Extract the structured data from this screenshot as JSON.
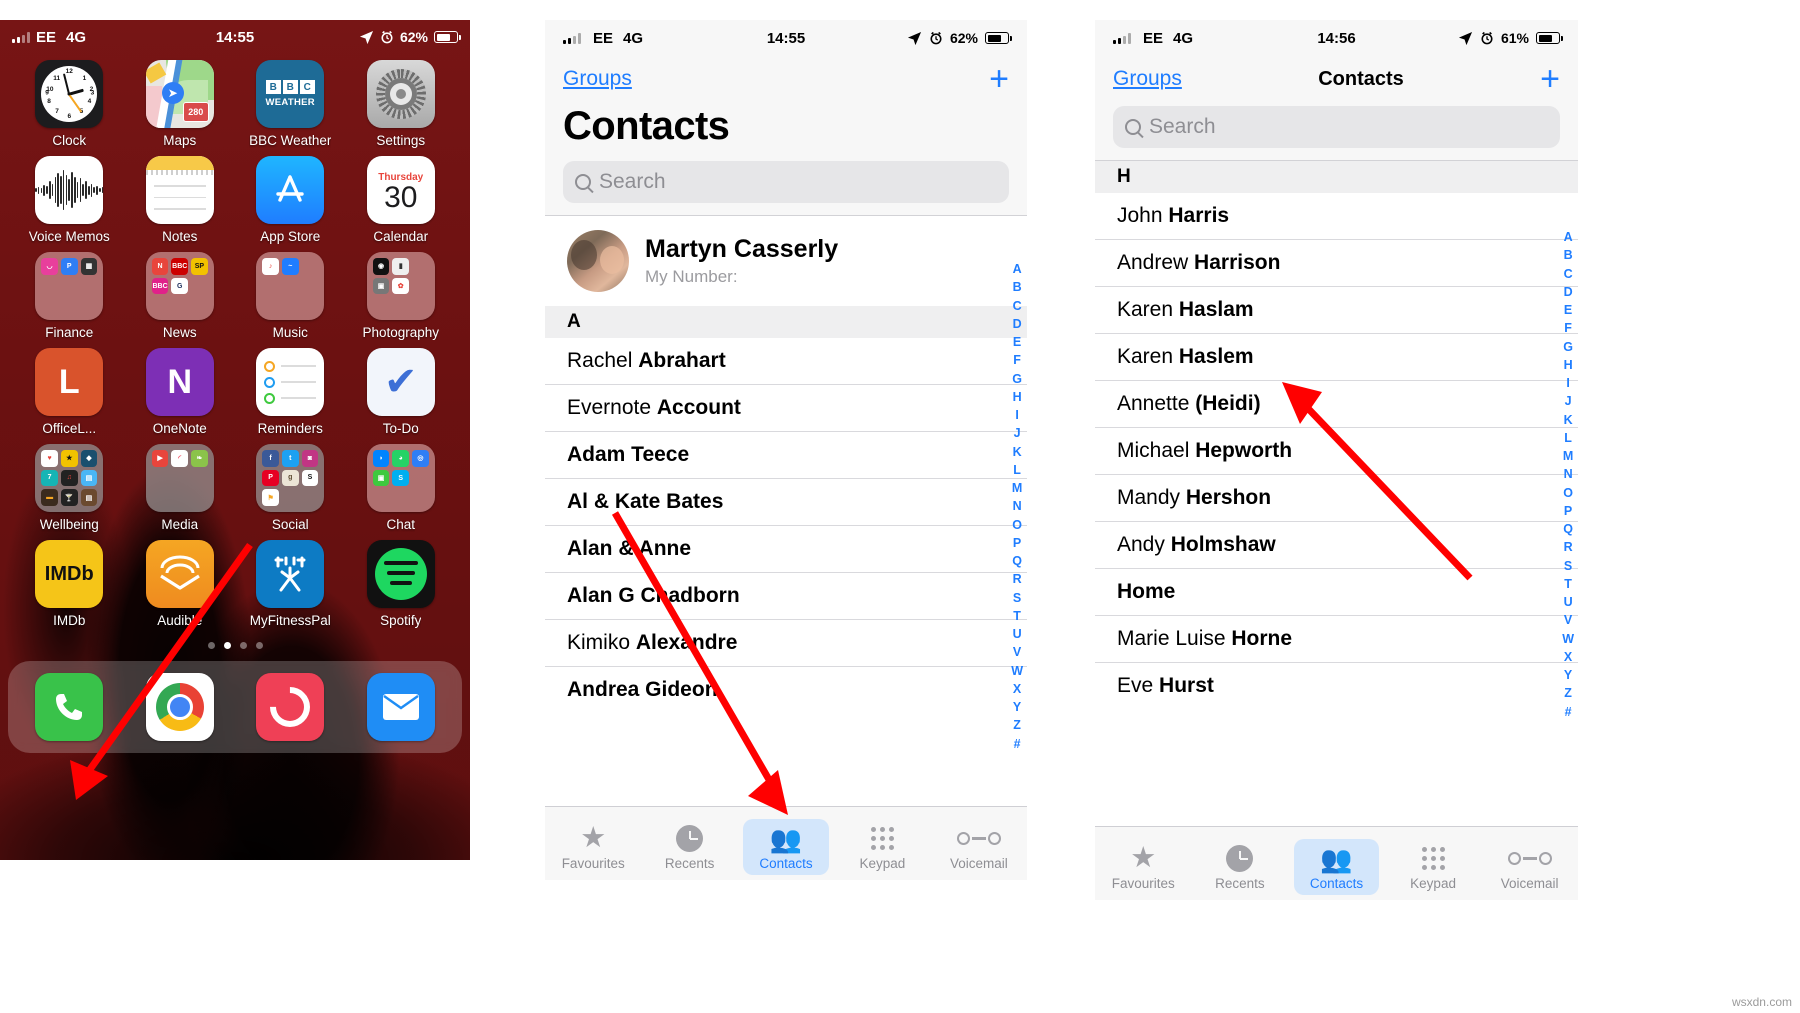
{
  "meta": {
    "watermark": "wsxdn.com",
    "accent_blue": "#1f7dff",
    "arrow_color": "#ff0000",
    "home_bg": "#6e1212"
  },
  "panel_home": {
    "status": {
      "signal": "signal-bars",
      "carrier": "EE",
      "network": "4G",
      "time": "14:55",
      "location": "location-arrow",
      "alarm": "alarm-clock",
      "battery_percent": "62%"
    },
    "apps": [
      {
        "label": "Clock",
        "icon": "clock-icon"
      },
      {
        "label": "Maps",
        "icon": "maps-icon",
        "badge": "280"
      },
      {
        "label": "BBC Weather",
        "icon": "bbc-weather-icon",
        "line1": [
          "B",
          "B",
          "C"
        ],
        "line2": "WEATHER"
      },
      {
        "label": "Settings",
        "icon": "settings-gear-icon"
      },
      {
        "label": "Voice Memos",
        "icon": "voice-memos-icon"
      },
      {
        "label": "Notes",
        "icon": "notes-icon"
      },
      {
        "label": "App Store",
        "icon": "app-store-icon"
      },
      {
        "label": "Calendar",
        "icon": "calendar-icon",
        "weekday": "Thursday",
        "day": "30"
      },
      {
        "label": "Finance",
        "icon": "folder-icon"
      },
      {
        "label": "News",
        "icon": "folder-icon"
      },
      {
        "label": "Music",
        "icon": "folder-icon"
      },
      {
        "label": "Photography",
        "icon": "folder-icon"
      },
      {
        "label": "OfficeL...",
        "icon": "office-lens-icon",
        "glyph": "L",
        "badge_dot": true
      },
      {
        "label": "OneNote",
        "icon": "onenote-icon",
        "glyph": "N"
      },
      {
        "label": "Reminders",
        "icon": "reminders-icon"
      },
      {
        "label": "To-Do",
        "icon": "to-do-icon"
      },
      {
        "label": "Wellbeing",
        "icon": "folder-icon"
      },
      {
        "label": "Media",
        "icon": "folder-icon"
      },
      {
        "label": "Social",
        "icon": "folder-icon"
      },
      {
        "label": "Chat",
        "icon": "folder-icon"
      },
      {
        "label": "IMDb",
        "icon": "imdb-icon",
        "glyph": "IMDb"
      },
      {
        "label": "Audible",
        "icon": "audible-icon"
      },
      {
        "label": "MyFitnessPal",
        "icon": "myfitnesspal-icon"
      },
      {
        "label": "Spotify",
        "icon": "spotify-icon"
      }
    ],
    "page_dots": {
      "count": 4,
      "active_index": 1
    },
    "dock": [
      {
        "label": "Phone",
        "icon": "phone-icon"
      },
      {
        "label": "Chrome",
        "icon": "chrome-icon"
      },
      {
        "label": "Pocket Casts",
        "icon": "pocket-casts-icon"
      },
      {
        "label": "Mail",
        "icon": "mail-icon"
      }
    ]
  },
  "panel_contacts": {
    "status": {
      "carrier": "EE",
      "network": "4G",
      "time": "14:55",
      "battery_percent": "62%"
    },
    "nav": {
      "back_label": "Groups",
      "add_label": "+"
    },
    "title": "Contacts",
    "search": {
      "placeholder": "Search"
    },
    "me": {
      "name": "Martyn Casserly",
      "number_label": "My Number:",
      "number_value": ""
    },
    "sections": [
      {
        "letter": "A",
        "contacts": [
          {
            "first": "Rachel ",
            "last": "Abrahart"
          },
          {
            "first": "Evernote ",
            "last": "Account"
          },
          {
            "first": "",
            "last": "Adam Teece"
          },
          {
            "first": "",
            "last": "Al & Kate Bates"
          },
          {
            "first": "",
            "last": "Alan & Anne"
          },
          {
            "first": "",
            "last": "Alan G Chadborn"
          },
          {
            "first": "Kimiko ",
            "last": "Alexandre"
          },
          {
            "first": "",
            "last": "Andrea Gideon"
          }
        ]
      }
    ],
    "index_letters": [
      "A",
      "B",
      "C",
      "D",
      "E",
      "F",
      "G",
      "H",
      "I",
      "J",
      "K",
      "L",
      "M",
      "N",
      "O",
      "P",
      "Q",
      "R",
      "S",
      "T",
      "U",
      "V",
      "W",
      "X",
      "Y",
      "Z",
      "#"
    ],
    "tabs": [
      {
        "label": "Favourites",
        "icon": "star-icon",
        "active": false
      },
      {
        "label": "Recents",
        "icon": "clock-icon",
        "active": false
      },
      {
        "label": "Contacts",
        "icon": "people-icon",
        "active": true
      },
      {
        "label": "Keypad",
        "icon": "keypad-icon",
        "active": false
      },
      {
        "label": "Voicemail",
        "icon": "voicemail-icon",
        "active": false
      }
    ]
  },
  "panel_h": {
    "status": {
      "carrier": "EE",
      "network": "4G",
      "time": "14:56",
      "battery_percent": "61%"
    },
    "nav": {
      "back_label": "Groups",
      "title": "Contacts",
      "add_label": "+"
    },
    "search": {
      "placeholder": "Search"
    },
    "sections": [
      {
        "letter": "H",
        "contacts": [
          {
            "first": "John ",
            "last": "Harris"
          },
          {
            "first": "Andrew ",
            "last": "Harrison"
          },
          {
            "first": "Karen ",
            "last": "Haslam"
          },
          {
            "first": "Karen ",
            "last": "Haslem"
          },
          {
            "first": "Annette ",
            "last": "(Heidi)"
          },
          {
            "first": "Michael ",
            "last": "Hepworth"
          },
          {
            "first": "Mandy ",
            "last": "Hershon"
          },
          {
            "first": "Andy ",
            "last": "Holmshaw"
          },
          {
            "first": "",
            "last": "Home"
          },
          {
            "first": "Marie Luise ",
            "last": "Horne"
          },
          {
            "first": "Eve ",
            "last": "Hurst"
          }
        ]
      }
    ],
    "index_letters": [
      "A",
      "B",
      "C",
      "D",
      "E",
      "F",
      "G",
      "H",
      "I",
      "J",
      "K",
      "L",
      "M",
      "N",
      "O",
      "P",
      "Q",
      "R",
      "S",
      "T",
      "U",
      "V",
      "W",
      "X",
      "Y",
      "Z",
      "#"
    ],
    "tabs": [
      {
        "label": "Favourites",
        "icon": "star-icon",
        "active": false
      },
      {
        "label": "Recents",
        "icon": "clock-icon",
        "active": false
      },
      {
        "label": "Contacts",
        "icon": "people-icon",
        "active": true
      },
      {
        "label": "Keypad",
        "icon": "keypad-icon",
        "active": false
      },
      {
        "label": "Voicemail",
        "icon": "voicemail-icon",
        "active": false
      }
    ]
  },
  "annotations": [
    {
      "name": "arrow-to-phone-dock",
      "target": "Phone app in dock"
    },
    {
      "name": "arrow-to-contacts-tab",
      "target": "Contacts tab"
    },
    {
      "name": "arrow-to-contact-row",
      "target": "Karen Haslem row"
    }
  ]
}
